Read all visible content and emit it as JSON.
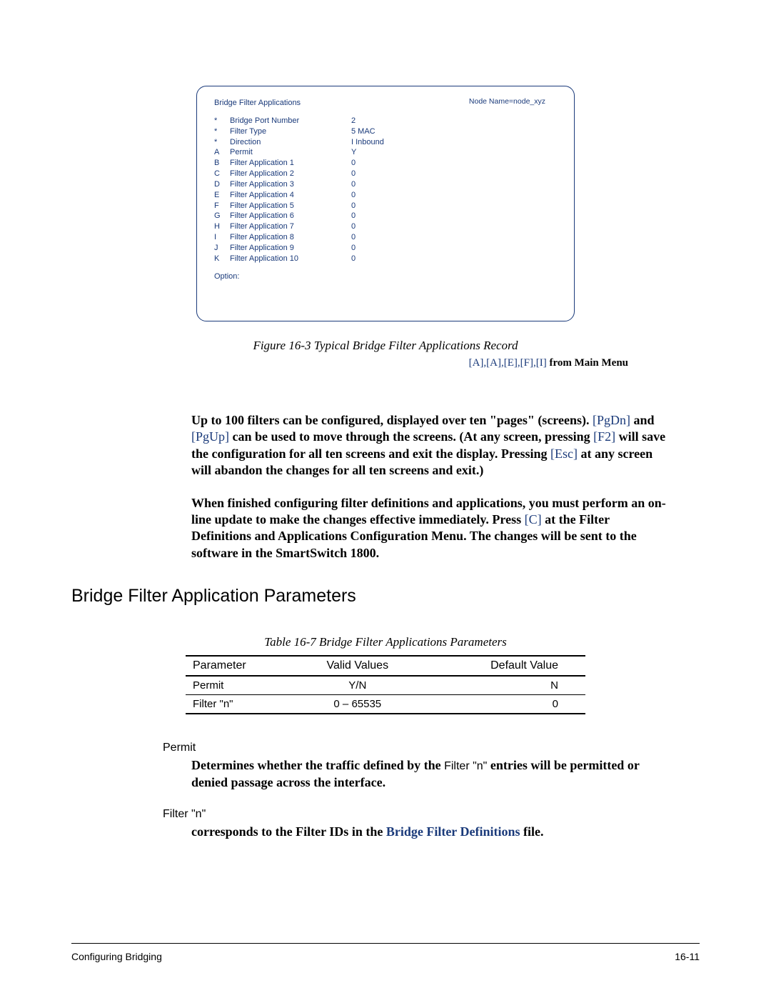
{
  "terminal": {
    "node_name": "Node Name=node_xyz",
    "title": "Bridge Filter Applications",
    "rows": [
      {
        "bullet": "*",
        "label": "Bridge Port Number",
        "value": "2"
      },
      {
        "bullet": "*",
        "label": "Filter Type",
        "value": "5 MAC"
      },
      {
        "bullet": "*",
        "label": "Direction",
        "value": "I Inbound"
      },
      {
        "bullet": "A",
        "label": "Permit",
        "value": "Y"
      },
      {
        "bullet": "B",
        "label": "Filter Application 1",
        "value": "0"
      },
      {
        "bullet": "C",
        "label": "Filter Application 2",
        "value": "0"
      },
      {
        "bullet": "D",
        "label": "Filter Application 3",
        "value": "0"
      },
      {
        "bullet": "E",
        "label": "Filter Application 4",
        "value": "0"
      },
      {
        "bullet": "F",
        "label": "Filter Application 5",
        "value": "0"
      },
      {
        "bullet": "G",
        "label": "Filter Application 6",
        "value": "0"
      },
      {
        "bullet": "H",
        "label": "Filter Application 7",
        "value": "0"
      },
      {
        "bullet": "I",
        "label": "Filter Application 8",
        "value": "0"
      },
      {
        "bullet": "J",
        "label": "Filter Application 9",
        "value": "0"
      },
      {
        "bullet": "K",
        "label": "Filter Application 10",
        "value": "0"
      }
    ],
    "option_label": "Option:"
  },
  "figure": {
    "caption": "Figure 16-3   Typical Bridge Filter Applications Record",
    "path_keys": "[A],[A],[E],[F],[I]",
    "path_suffix": "   from Main Menu"
  },
  "para1": {
    "t1": "Up to 100 filters can be configured, displayed over ten \"pages\" (screens). ",
    "k1": "[PgDn]",
    "t2": " and ",
    "k2": "[PgUp]",
    "t3": " can be used to move through the screens. (At any screen, pressing ",
    "k3": "[F2]",
    "t4": " will save the configuration for all ten screens and exit the display. Pressing ",
    "k4": "[Esc]",
    "t5": " at any screen will abandon the changes for all ten screens and exit.)"
  },
  "para2": {
    "t1": "When finished configuring filter definitions and applications, you must perform an on-line update to make the changes effective immediately. Press ",
    "k1": "[C]",
    "t2": " at the Filter Definitions and Applications Configuration Menu. The changes will be sent to the software in the SmartSwitch 1800."
  },
  "section_heading": "Bridge Filter Application Parameters",
  "table": {
    "caption": "Table 16-7   Bridge Filter Applications Parameters",
    "headers": {
      "c1": "Parameter",
      "c2": "Valid Values",
      "c3": "Default Value"
    },
    "rows": [
      {
        "p": "Permit",
        "v": "Y/N",
        "d": "N"
      },
      {
        "p": "Filter \"n\"",
        "v": "0 – 65535",
        "d": "0"
      }
    ]
  },
  "defs": {
    "permit_term": "Permit",
    "permit_body_1": "Determines whether the traffic defined by the ",
    "permit_body_sans": "Filter \"n\"",
    "permit_body_2": " entries will be permitted or denied passage across the interface.",
    "filter_term": "Filter \"n\"",
    "filter_body_1": "corresponds to the Filter IDs in the ",
    "filter_link": "Bridge Filter Definitions",
    "filter_body_2": " file."
  },
  "footer": {
    "left": "Configuring Bridging",
    "right": "16-11"
  }
}
